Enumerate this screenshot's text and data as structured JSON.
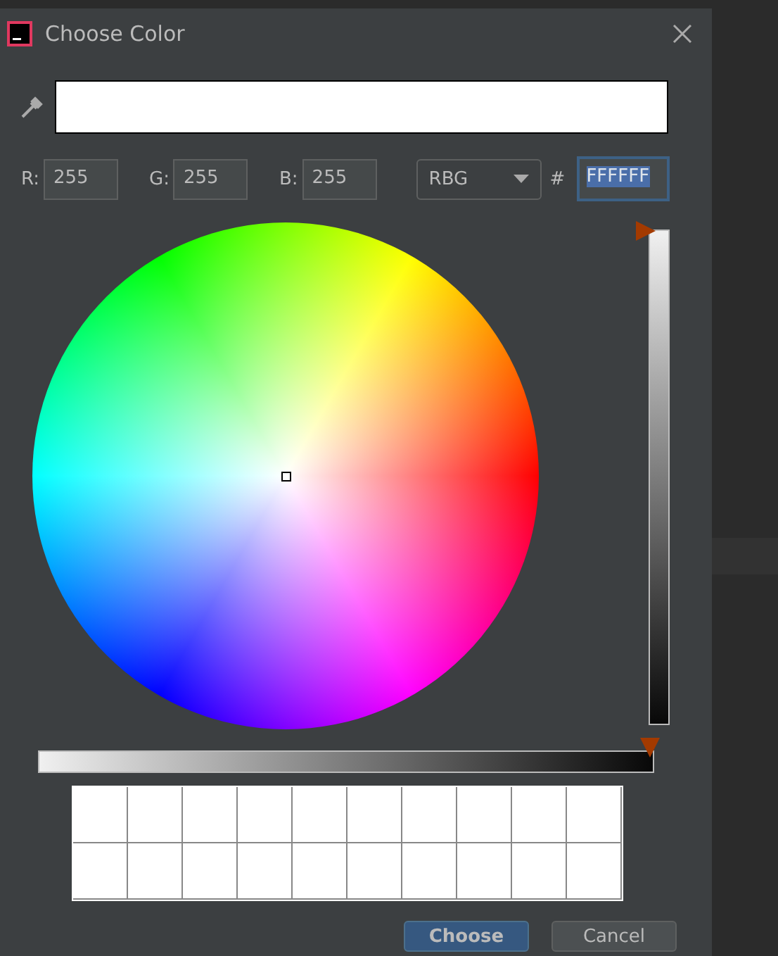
{
  "window": {
    "title": "Choose Color"
  },
  "preview": {
    "color": "#ffffff"
  },
  "channels": [
    {
      "label": "R:",
      "value": "255"
    },
    {
      "label": "G:",
      "value": "255"
    },
    {
      "label": "B:",
      "value": "255"
    }
  ],
  "mode": {
    "value": "RBG"
  },
  "hex": {
    "prefix": "#",
    "value": "FFFFFF",
    "selected": true
  },
  "brightness": {
    "level": 1
  },
  "opacity": {
    "level": 1
  },
  "recent_colors": [
    {
      "color": "#ffffff"
    },
    {
      "color": "#ffffff"
    },
    {
      "color": "#ffffff"
    },
    {
      "color": "#ffffff"
    },
    {
      "color": "#ffffff"
    },
    {
      "color": "#ffffff"
    },
    {
      "color": "#ffffff"
    },
    {
      "color": "#ffffff"
    },
    {
      "color": "#ffffff"
    },
    {
      "color": "#ffffff"
    },
    {
      "color": "#ffffff"
    },
    {
      "color": "#ffffff"
    },
    {
      "color": "#ffffff"
    },
    {
      "color": "#ffffff"
    },
    {
      "color": "#ffffff"
    },
    {
      "color": "#ffffff"
    },
    {
      "color": "#ffffff"
    },
    {
      "color": "#ffffff"
    },
    {
      "color": "#ffffff"
    },
    {
      "color": "#ffffff"
    }
  ],
  "buttons": [
    {
      "label": "Choose",
      "selected": true
    },
    {
      "label": "Cancel",
      "selected": false
    }
  ]
}
